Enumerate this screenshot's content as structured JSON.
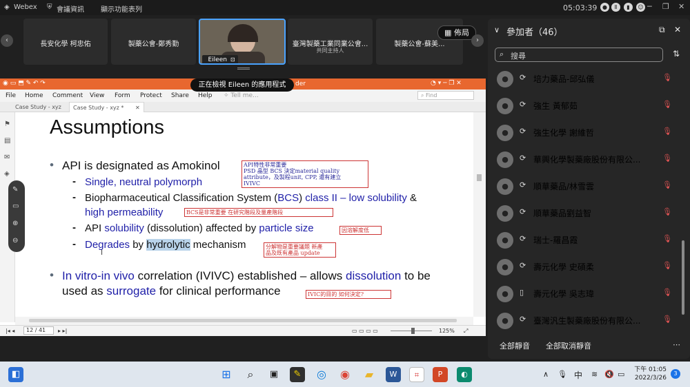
{
  "webex": {
    "app_name": "Webex",
    "meeting_info": "會議資訊",
    "display_option": "顯示功能表列",
    "time": "05:03:39"
  },
  "video_strip": {
    "tiles": [
      {
        "name": "長安化學 柯忠佑",
        "sub": ""
      },
      {
        "name": "製藥公會-鄭秀勤",
        "sub": ""
      },
      {
        "name": "Eileen",
        "sub": ""
      },
      {
        "name": "臺灣製藥工業同業公會...",
        "sub": "共同主持人"
      },
      {
        "name": "製藥公會-蘇美...",
        "sub": ""
      }
    ],
    "layout_label": "佈局"
  },
  "share_banner": "正在檢視 Eileen 的應用程式",
  "pdf_app": {
    "title_suffix": "der",
    "menu": [
      "File",
      "Home",
      "Comment",
      "View",
      "Form",
      "Protect",
      "Share",
      "Help"
    ],
    "tell_me_placeholder": "Tell me...",
    "find_placeholder": "Find",
    "tabs": [
      "Case Study - xyz",
      "Case Study - xyz *"
    ],
    "status": {
      "page": "12 / 41",
      "zoom": "125%"
    }
  },
  "slide": {
    "title": "Assumptions",
    "bullet1": "API is designated as Amokinol",
    "sub1": "Single, neutral polymorph",
    "sub2_a": "Biopharmaceutical Classification System (",
    "sub2_b": "BCS",
    "sub2_c": ") ",
    "sub2_d": "class II – low solubility",
    "sub2_e": " &",
    "sub2_f": "high permeability",
    "sub3_a": "API ",
    "sub3_b": "solubility",
    "sub3_c": " (dissolution) affected by ",
    "sub3_d": "particle size",
    "sub4_a": "Degrades",
    "sub4_b": " by ",
    "sub4_c": "hydrolytic",
    "sub4_d": " mechanism",
    "bullet2_a": "In vitro-in vivo",
    "bullet2_b": " correlation (IVIVC) established – allows ",
    "bullet2_c": "dissolution",
    "bullet2_d": " to be",
    "bullet2_e": "used as ",
    "bullet2_f": "surrogate",
    "bullet2_g": " for clinical performance",
    "notes": {
      "n1_l1": "API特性非常重要",
      "n1_l2": "PSD 晶型 BCS 決定material quality",
      "n1_l3": "attribute，及製程unit, CPP, 還有建立",
      "n1_l4": "IVIVC",
      "n2": "BCS是非常重要 在研究階段及量產階段",
      "n3": "因溶解度低",
      "n4_l1": "分解物是重要議題  新產",
      "n4_l2": "品及既有產品 update",
      "n5": "IVIC的目的  如何決定?"
    }
  },
  "participants": {
    "header": "參加者（46）",
    "search_placeholder": "搜尋",
    "list": [
      "培力藥品-邱弘儀",
      "強生 黃郁茹",
      "強生化學 謝維哲",
      "華興化學製藥廠股份有限公...",
      "順華藥品/林雪雲",
      "順華藥品劉益智",
      "瑞士-羅昌霞",
      "壽元化學 史碩柔",
      "壽元化學 吳志瑋",
      "臺灣汎生製藥廠股份有限公..."
    ],
    "mute_all": "全部靜音",
    "unmute_all": "全部取消靜音"
  },
  "taskbar": {
    "ime": "中",
    "time": "下午 01:05",
    "date": "2022/3/26",
    "badge": "3"
  },
  "colors": {
    "accent": "#4aa3ff",
    "pdf_orange": "#e8672f",
    "slide_blue": "#1f1fa8",
    "note_red": "#cc3333",
    "mic_red": "#e05454"
  }
}
